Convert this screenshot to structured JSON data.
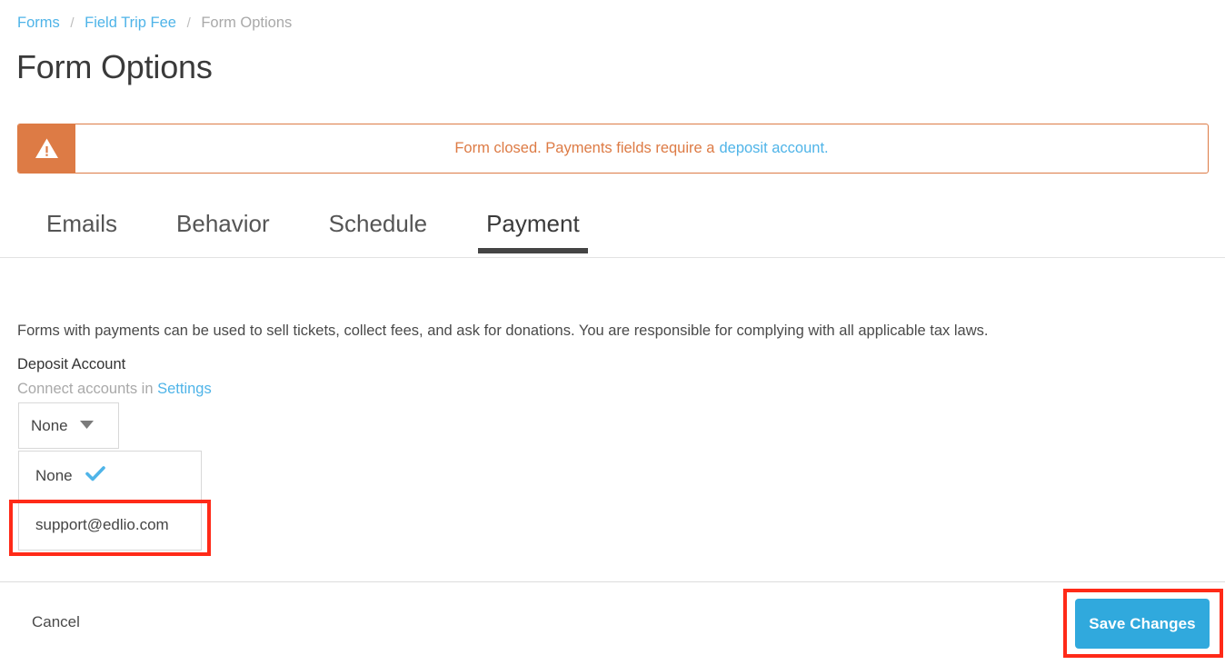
{
  "breadcrumb": {
    "items": [
      {
        "label": "Forms",
        "type": "link"
      },
      {
        "label": "Field Trip Fee",
        "type": "link"
      },
      {
        "label": "Form Options",
        "type": "current"
      }
    ],
    "separator": "/"
  },
  "page": {
    "title": "Form Options"
  },
  "alert": {
    "icon": "warning-triangle-icon",
    "message": "Form closed. Payments fields require a",
    "link_text": "deposit account.",
    "border_color": "#DD7B45",
    "icon_bg_color": "#DD7B45",
    "text_color": "#DD7B45",
    "link_color": "#4FB4E8"
  },
  "tabs": {
    "items": [
      {
        "label": "Emails",
        "active": false
      },
      {
        "label": "Behavior",
        "active": false
      },
      {
        "label": "Schedule",
        "active": false
      },
      {
        "label": "Payment",
        "active": true
      }
    ],
    "active_underline_color": "#444444"
  },
  "main": {
    "intro": "Forms with payments can be used to sell tickets, collect fees, and ask for donations. You are responsible for complying with all applicable tax laws.",
    "deposit_account": {
      "label": "Deposit Account",
      "help_prefix": "Connect accounts in",
      "help_link": "Settings",
      "select": {
        "value": "None",
        "caret_icon": "chevron-down-icon",
        "open": true,
        "options": [
          {
            "label": "None",
            "selected": true,
            "check_icon": "check-icon"
          },
          {
            "label": "support@edlio.com",
            "selected": false
          }
        ]
      }
    }
  },
  "footer": {
    "cancel_label": "Cancel",
    "save_label": "Save Changes",
    "save_color": "#30A9DD"
  },
  "annotations": {
    "color": "#FF2A18",
    "highlighted": [
      "support@edlio.com option",
      "Save Changes button"
    ]
  }
}
